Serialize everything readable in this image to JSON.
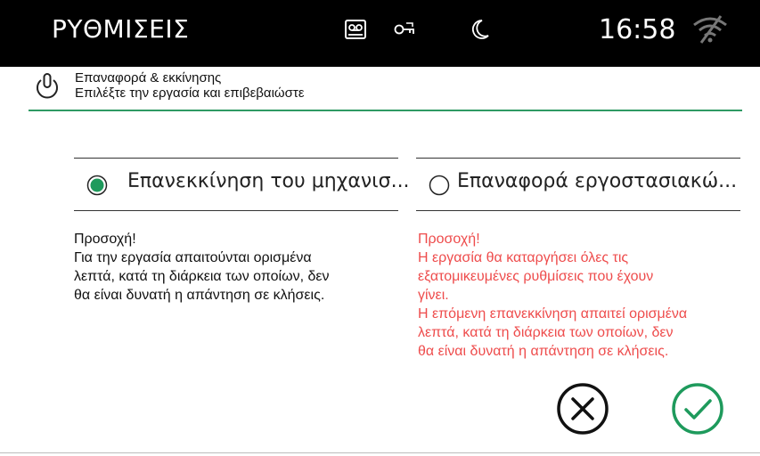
{
  "header_bar": {
    "title": "ΡΥΘΜΙΣΕΙΣ",
    "clock": "16:58",
    "icons": [
      "voicemail-icon",
      "key-icon",
      "moon-icon",
      "wifi-off-icon"
    ]
  },
  "section": {
    "icon": "power-icon",
    "title": "Επαναφορά & εκκίνησης",
    "subtitle": "Επιλέξτε την εργασία και επιβεβαιώστε"
  },
  "options": [
    {
      "label": "Επανεκκίνηση του μηχανισ...",
      "selected": true
    },
    {
      "label": "Επαναφορά εργοστασιακώ...",
      "selected": false
    }
  ],
  "warnings": {
    "left": [
      "Προσοχή!",
      "Για την εργασία απαιτούνται ορισμένα",
      "λεπτά, κατά τη διάρκεια των οποίων, δεν",
      "θα είναι δυνατή η απάντηση σε κλήσεις."
    ],
    "right": [
      "Προσοχή!",
      "Η εργασία θα καταργήσει όλες τις",
      "εξατομικευμένες ρυθμίσεις που έχουν",
      "γίνει.",
      "Η επόμενη επανεκκίνηση απαιτεί ορισμένα",
      "λεπτά, κατά τη διάρκεια των οποίων, δεν",
      "θα είναι δυνατή η απάντηση σε κλήσεις."
    ]
  },
  "actions": {
    "cancel_icon": "cancel-x-icon",
    "confirm_icon": "confirm-check-icon"
  },
  "colors": {
    "accent": "#2f9a64",
    "radio_selected": "#1e9a5c",
    "warning": "#ee4c4c",
    "topbar": "#000000"
  }
}
